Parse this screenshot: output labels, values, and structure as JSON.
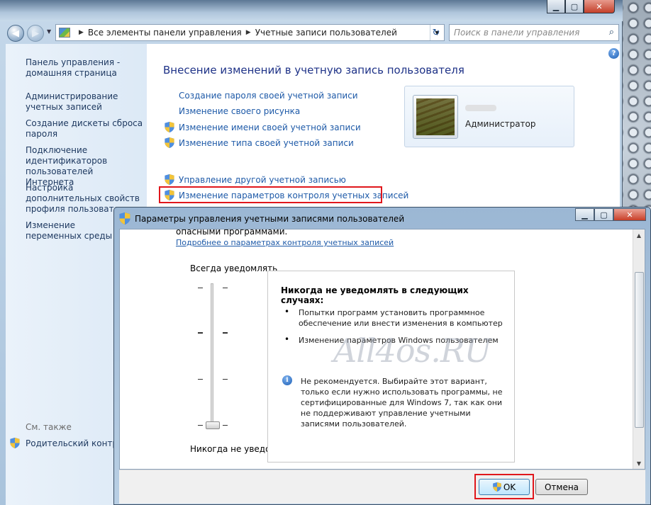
{
  "window": {
    "address": [
      "Все элементы панели управления",
      "Учетные записи пользователей"
    ],
    "search_placeholder": "Поиск в панели управления",
    "help": "?"
  },
  "sidebar": {
    "items": [
      {
        "label": "Панель управления - домашняя страница"
      },
      {
        "label": "Администрирование учетных записей"
      },
      {
        "label": "Создание дискеты сброса пароля"
      },
      {
        "label": "Подключение идентификаторов пользователей Интернета"
      },
      {
        "label": "Настройка дополнительных свойств профиля пользователя"
      },
      {
        "label": "Изменение переменных среды"
      }
    ],
    "see_also": "См. также",
    "parental": "Родительский контроль"
  },
  "main": {
    "title": "Внесение изменений в учетную запись пользователя",
    "links": [
      "Создание пароля своей учетной записи",
      "Изменение своего рисунка",
      "Изменение имени своей учетной записи",
      "Изменение типа своей учетной записи",
      "Управление другой учетной записью",
      "Изменение параметров контроля учетных записей"
    ],
    "account_role": "Администратор"
  },
  "dialog": {
    "title": "Параметры управления учетными записями пользователей",
    "cut_text": "опасными программами.",
    "more_link": "Подробнее о параметрах контроля учетных записей",
    "slider_top": "Всегда уведомлять",
    "slider_bottom": "Никогда не уведомлять",
    "slider_level": 0,
    "desc_heading": "Никогда не уведомлять в следующих случаях:",
    "bullets": [
      "Попытки программ установить программное обеспечение или внести изменения в компьютер",
      "Изменение параметров Windows пользователем"
    ],
    "warning": "Не рекомендуется. Выбирайте этот вариант, только если нужно использовать программы, не сертифицированные для Windows 7, так как они не поддерживают управление учетными записями пользователей.",
    "ok": "OK",
    "cancel": "Отмена"
  },
  "watermark": "All4os.RU",
  "colors": {
    "link": "#1e5aa8",
    "title": "#1e3287",
    "highlight": "#e0171c"
  }
}
